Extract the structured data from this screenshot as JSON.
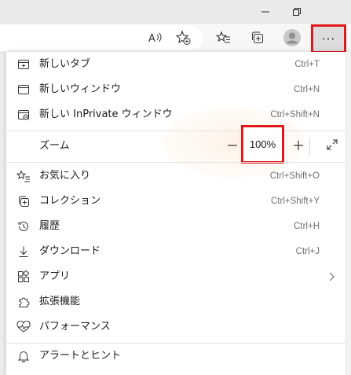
{
  "window": {
    "controls": [
      "minimize-icon",
      "restore-icon"
    ]
  },
  "toolbar": {
    "icons": [
      "read-aloud-icon",
      "add-favorite-icon",
      "favorites-icon",
      "collections-icon",
      "profile-avatar-icon"
    ],
    "more_label": "···"
  },
  "menu": {
    "items_top": [
      {
        "label": "新しいタブ",
        "shortcut": "Ctrl+T",
        "icon": "new-tab-icon"
      },
      {
        "label": "新しいウィンドウ",
        "shortcut": "Ctrl+N",
        "icon": "new-window-icon"
      },
      {
        "label": "新しい InPrivate ウィンドウ",
        "shortcut": "Ctrl+Shift+N",
        "icon": "inprivate-window-icon"
      }
    ],
    "zoom": {
      "label": "ズーム",
      "minus": "—",
      "value": "100%",
      "plus": "+",
      "fullscreen_icon": "fullscreen-icon"
    },
    "items_mid": [
      {
        "label": "お気に入り",
        "shortcut": "Ctrl+Shift+O",
        "icon": "favorites-icon"
      },
      {
        "label": "コレクション",
        "shortcut": "Ctrl+Shift+Y",
        "icon": "collections-icon"
      },
      {
        "label": "履歴",
        "shortcut": "Ctrl+H",
        "icon": "history-icon"
      },
      {
        "label": "ダウンロード",
        "shortcut": "Ctrl+J",
        "icon": "download-icon"
      },
      {
        "label": "アプリ",
        "shortcut": "",
        "icon": "apps-icon",
        "submenu": true
      },
      {
        "label": "拡張機能",
        "shortcut": "",
        "icon": "extensions-icon"
      },
      {
        "label": "パフォーマンス",
        "shortcut": "",
        "icon": "performance-icon"
      }
    ],
    "items_bottom": [
      {
        "label": "アラートとヒント",
        "shortcut": "",
        "icon": "alerts-bell-icon"
      }
    ]
  },
  "colors": {
    "highlight": "#e0191b",
    "menu_bg": "#ffffff",
    "separator": "#e3e3e3"
  }
}
